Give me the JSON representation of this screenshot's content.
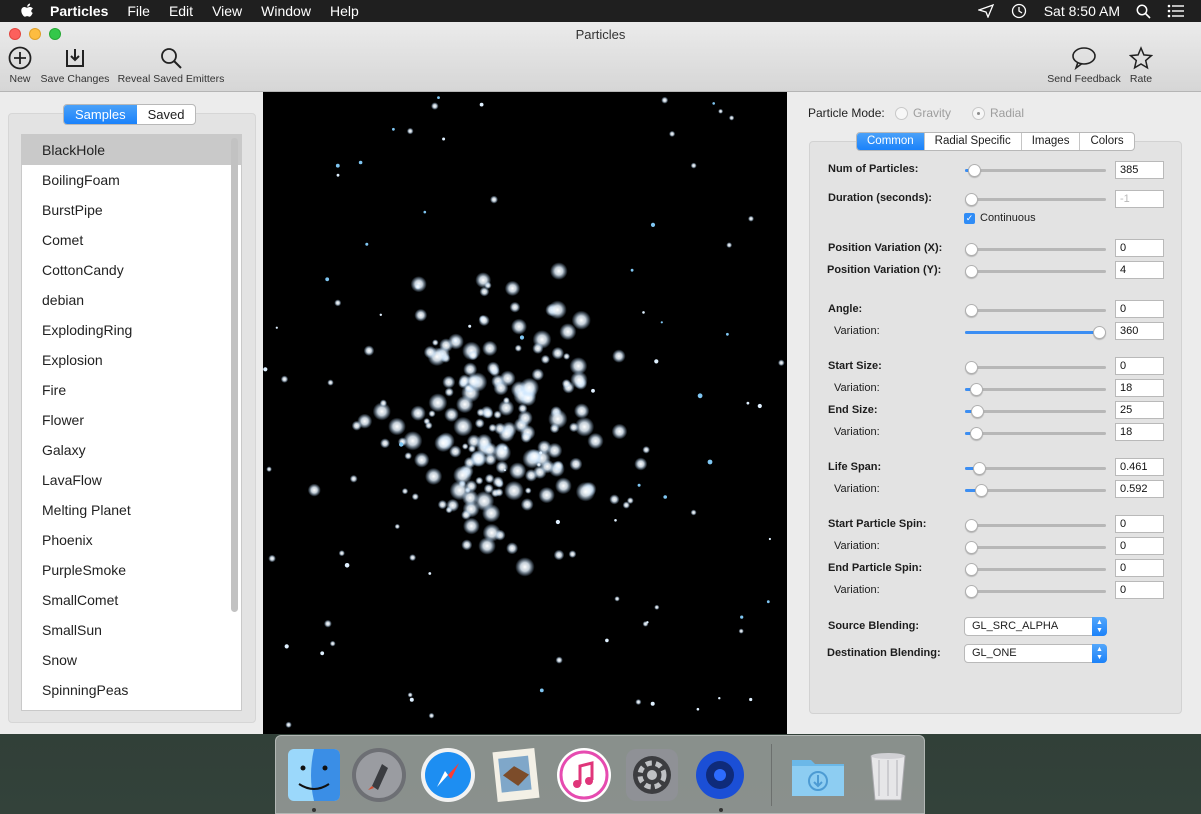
{
  "menubar": {
    "app_name": "Particles",
    "menus": [
      "File",
      "Edit",
      "View",
      "Window",
      "Help"
    ],
    "clock": "Sat 8:50 AM"
  },
  "window": {
    "title": "Particles",
    "toolbar": {
      "new_label": "New",
      "save_label": "Save Changes",
      "reveal_label": "Reveal Saved Emitters",
      "feedback_label": "Send Feedback",
      "rate_label": "Rate"
    }
  },
  "sidebar": {
    "segments": [
      "Samples",
      "Saved"
    ],
    "active_segment": "Samples",
    "items": [
      "BlackHole",
      "BoilingFoam",
      "BurstPipe",
      "Comet",
      "CottonCandy",
      "debian",
      "ExplodingRing",
      "Explosion",
      "Fire",
      "Flower",
      "Galaxy",
      "LavaFlow",
      "Melting Planet",
      "Phoenix",
      "PurpleSmoke",
      "SmallComet",
      "SmallSun",
      "Snow",
      "SpinningPeas"
    ],
    "selected": "BlackHole"
  },
  "settings": {
    "mode_label": "Particle Mode:",
    "mode_options": [
      "Gravity",
      "Radial"
    ],
    "mode_selected": "Radial",
    "tabs": [
      "Common",
      "Radial Specific",
      "Images",
      "Colors"
    ],
    "active_tab": "Common",
    "continuous_label": "Continuous",
    "continuous_checked": true,
    "fields": {
      "num_particles": {
        "label": "Num of Particles:",
        "value": "385",
        "level": 0.02
      },
      "duration": {
        "label": "Duration (seconds):",
        "value": "-1",
        "level": 0.0
      },
      "pos_var_x": {
        "label": "Position Variation (X):",
        "value": "0",
        "level": 0.0
      },
      "pos_var_y": {
        "label": "Position Variation (Y):",
        "value": "4",
        "level": 0.0
      },
      "angle": {
        "label": "Angle:",
        "value": "0",
        "level": 0.0
      },
      "angle_var": {
        "label": "Variation:",
        "value": "360",
        "level": 1.0
      },
      "start_size": {
        "label": "Start Size:",
        "value": "0",
        "level": 0.0
      },
      "start_size_var": {
        "label": "Variation:",
        "value": "18",
        "level": 0.04
      },
      "end_size": {
        "label": "End Size:",
        "value": "25",
        "level": 0.05
      },
      "end_size_var": {
        "label": "Variation:",
        "value": "18",
        "level": 0.04
      },
      "life_span": {
        "label": "Life Span:",
        "value": "0.461",
        "level": 0.06
      },
      "life_span_var": {
        "label": "Variation:",
        "value": "0.592",
        "level": 0.08
      },
      "start_spin": {
        "label": "Start Particle Spin:",
        "value": "0",
        "level": 0.0
      },
      "start_spin_var": {
        "label": "Variation:",
        "value": "0",
        "level": 0.0
      },
      "end_spin": {
        "label": "End Particle Spin:",
        "value": "0",
        "level": 0.0
      },
      "end_spin_var": {
        "label": "Variation:",
        "value": "0",
        "level": 0.0
      }
    },
    "source_blending_label": "Source Blending:",
    "source_blending": "GL_SRC_ALPHA",
    "dest_blending_label": "Destination Blending:",
    "dest_blending": "GL_ONE"
  },
  "dock": {
    "apps": [
      "finder-icon",
      "launchpad-icon",
      "safari-icon",
      "mail-icon",
      "itunes-icon",
      "system-preferences-icon",
      "particles-icon",
      "downloads-folder-icon",
      "trash-icon"
    ]
  },
  "colors": {
    "accent": "#1a82fb",
    "menubar": "#1f1f1f",
    "preview_bg": "#000000",
    "particle": "#dff0ff"
  }
}
